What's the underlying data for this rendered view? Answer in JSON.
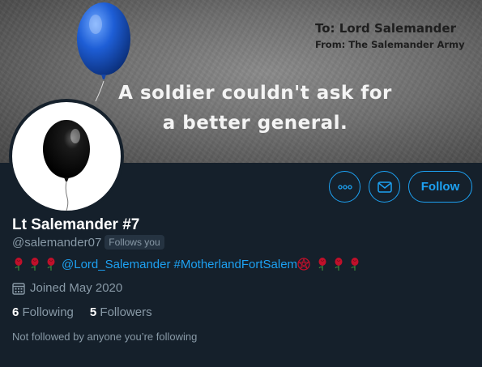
{
  "banner": {
    "to_text": "To: Lord Salemander",
    "from_text": "From: The Salemander Army",
    "message_line1": "A soldier couldn't ask for",
    "message_line2": "a better general."
  },
  "profile": {
    "display_name": "Lt Salemander #7",
    "handle": "@salemander07",
    "follows_you_badge": "Follows you",
    "bio_mention": "@Lord_Salemander",
    "bio_hashtag": "#MotherlandFortSalem",
    "joined": "Joined May 2020",
    "following_count": "6",
    "following_label": "Following",
    "followers_count": "5",
    "followers_label": "Followers",
    "not_followed_text": "Not followed by anyone you’re following"
  },
  "actions": {
    "more_icon": "more-icon",
    "message_icon": "envelope-icon",
    "follow_label": "Follow"
  },
  "colors": {
    "background": "#15202b",
    "accent": "#1da1f2",
    "secondary_text": "#8899a6",
    "rose": "#c0102a"
  }
}
